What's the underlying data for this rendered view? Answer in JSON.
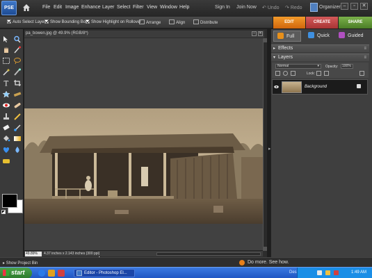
{
  "menubar": {
    "logo_text": "PSE",
    "items": [
      "File",
      "Edit",
      "Image",
      "Enhance",
      "Layer",
      "Select",
      "Filter",
      "View",
      "Window",
      "Help"
    ],
    "sign_in": "Sign In",
    "join_now": "Join Now",
    "undo": "Undo",
    "redo": "Redo",
    "organizer": "Organizer"
  },
  "options": {
    "auto_select": "Auto Select Layer",
    "bounding_box": "Show Bounding Box",
    "highlight": "Show Highlight on Rollover",
    "arrange": "Arrange",
    "align": "Align",
    "distribute": "Distribute"
  },
  "tabs": {
    "edit": "EDIT",
    "create": "CREATE",
    "share": "SHARE"
  },
  "modes": {
    "full": "Full",
    "quick": "Quick",
    "guided": "Guided"
  },
  "document": {
    "title": "pa_bowen.jpg @ 49.9% (RGB/8*)",
    "zoom": "49.89%",
    "info": "4.37 inches x 2.143 inches (300 ppi)"
  },
  "panels": {
    "effects": "Effects",
    "layers": "Layers"
  },
  "layers": {
    "blend_mode": "Normal",
    "opacity_label": "Opacity:",
    "opacity_value": "100%",
    "lock_label": "Lock:",
    "items": [
      {
        "name": "Background",
        "visible": true,
        "locked": true
      }
    ]
  },
  "bin": {
    "label": "Show Project Bin",
    "do_more": "Do more. See how."
  },
  "taskbar": {
    "start": "start",
    "task": "Editor - Photoshop El...",
    "desktop": "Desktop",
    "clock": "1:49 AM"
  },
  "colors": {
    "edit_tab": "#e07a1a",
    "create_tab": "#b84040",
    "share_tab": "#5c8f33",
    "accent": "#3f78c8"
  }
}
